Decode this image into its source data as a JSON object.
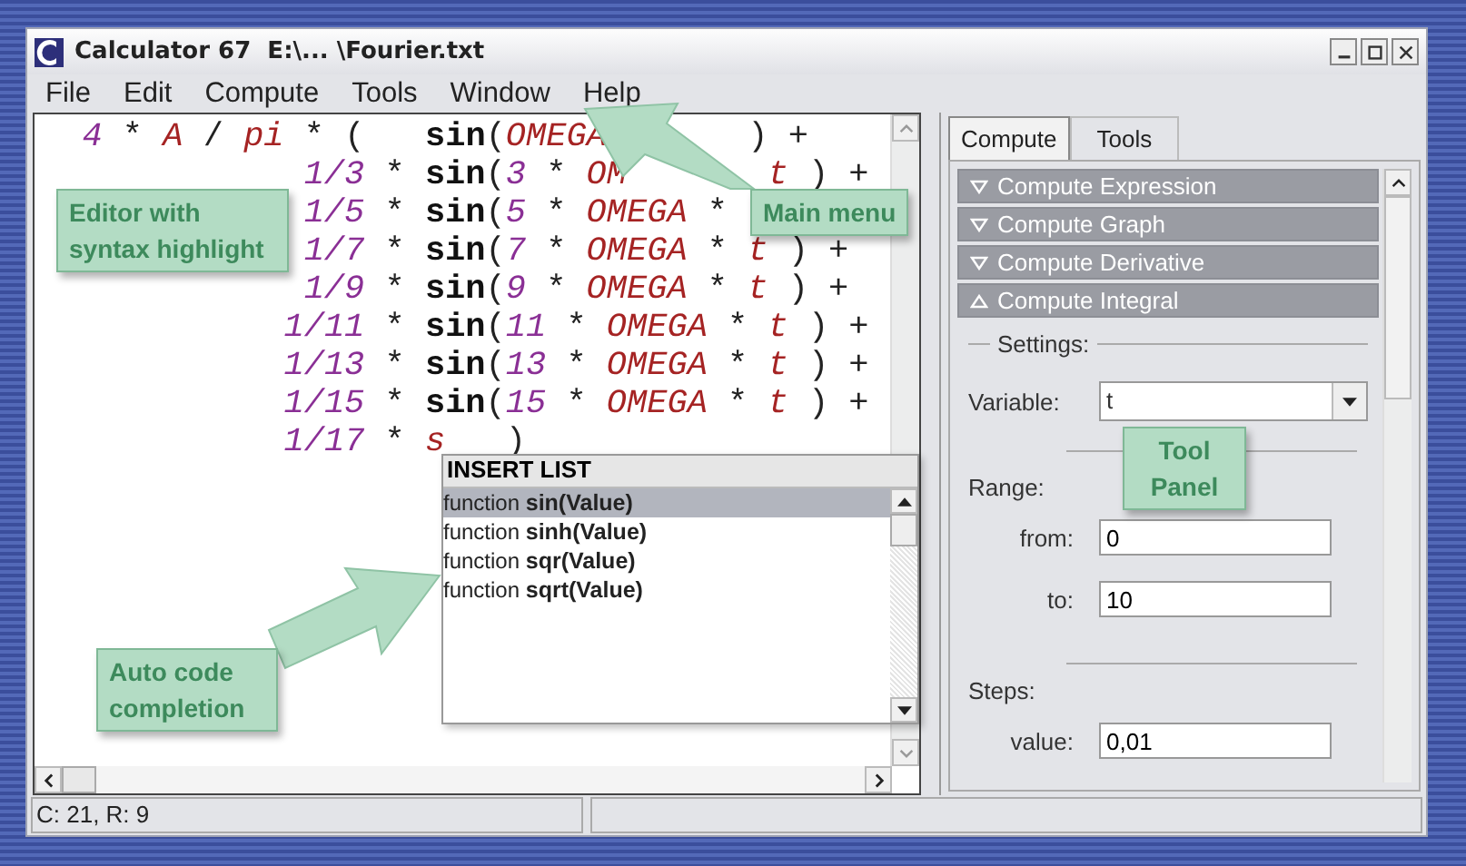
{
  "window": {
    "title": "Calculator 67  E:\\... \\Fourier.txt"
  },
  "menu": [
    "File",
    "Edit",
    "Compute",
    "Tools",
    "Window",
    "Help"
  ],
  "editor": {
    "lines": [
      [
        {
          "kind": "num",
          "text": "  4"
        },
        {
          "kind": "op",
          "text": " * "
        },
        {
          "kind": "var",
          "text": "A"
        },
        {
          "kind": "op",
          "text": " / "
        },
        {
          "kind": "var",
          "text": "pi"
        },
        {
          "kind": "op",
          "text": " * (   "
        },
        {
          "kind": "fn",
          "text": "sin"
        },
        {
          "kind": "op",
          "text": "("
        },
        {
          "kind": "var",
          "text": "OMEGA"
        },
        {
          "kind": "op",
          "text": "       ) +"
        }
      ],
      [
        {
          "kind": "num",
          "text": "             1/3"
        },
        {
          "kind": "op",
          "text": " * "
        },
        {
          "kind": "fn",
          "text": "sin"
        },
        {
          "kind": "op",
          "text": "("
        },
        {
          "kind": "num",
          "text": "3"
        },
        {
          "kind": "op",
          "text": " * "
        },
        {
          "kind": "var",
          "text": "OM"
        },
        {
          "kind": "var",
          "text": "       t"
        },
        {
          "kind": "op",
          "text": " ) +"
        }
      ],
      [
        {
          "kind": "num",
          "text": "             1/5"
        },
        {
          "kind": "op",
          "text": " * "
        },
        {
          "kind": "fn",
          "text": "sin"
        },
        {
          "kind": "op",
          "text": "("
        },
        {
          "kind": "num",
          "text": "5"
        },
        {
          "kind": "op",
          "text": " * "
        },
        {
          "kind": "var",
          "text": "OMEGA"
        },
        {
          "kind": "op",
          "text": " *"
        }
      ],
      [
        {
          "kind": "num",
          "text": "             1/7"
        },
        {
          "kind": "op",
          "text": " * "
        },
        {
          "kind": "fn",
          "text": "sin"
        },
        {
          "kind": "op",
          "text": "("
        },
        {
          "kind": "num",
          "text": "7"
        },
        {
          "kind": "op",
          "text": " * "
        },
        {
          "kind": "var",
          "text": "OMEGA"
        },
        {
          "kind": "op",
          "text": " * "
        },
        {
          "kind": "var",
          "text": "t"
        },
        {
          "kind": "op",
          "text": " ) +"
        }
      ],
      [
        {
          "kind": "num",
          "text": "             1/9"
        },
        {
          "kind": "op",
          "text": " * "
        },
        {
          "kind": "fn",
          "text": "sin"
        },
        {
          "kind": "op",
          "text": "("
        },
        {
          "kind": "num",
          "text": "9"
        },
        {
          "kind": "op",
          "text": " * "
        },
        {
          "kind": "var",
          "text": "OMEGA"
        },
        {
          "kind": "op",
          "text": " * "
        },
        {
          "kind": "var",
          "text": "t"
        },
        {
          "kind": "op",
          "text": " ) +"
        }
      ],
      [
        {
          "kind": "num",
          "text": "            1/11"
        },
        {
          "kind": "op",
          "text": " * "
        },
        {
          "kind": "fn",
          "text": "sin"
        },
        {
          "kind": "op",
          "text": "("
        },
        {
          "kind": "num",
          "text": "11"
        },
        {
          "kind": "op",
          "text": " * "
        },
        {
          "kind": "var",
          "text": "OMEGA"
        },
        {
          "kind": "op",
          "text": " * "
        },
        {
          "kind": "var",
          "text": "t"
        },
        {
          "kind": "op",
          "text": " ) +"
        }
      ],
      [
        {
          "kind": "num",
          "text": "            1/13"
        },
        {
          "kind": "op",
          "text": " * "
        },
        {
          "kind": "fn",
          "text": "sin"
        },
        {
          "kind": "op",
          "text": "("
        },
        {
          "kind": "num",
          "text": "13"
        },
        {
          "kind": "op",
          "text": " * "
        },
        {
          "kind": "var",
          "text": "OMEGA"
        },
        {
          "kind": "op",
          "text": " * "
        },
        {
          "kind": "var",
          "text": "t"
        },
        {
          "kind": "op",
          "text": " ) +"
        }
      ],
      [
        {
          "kind": "num",
          "text": "            1/15"
        },
        {
          "kind": "op",
          "text": " * "
        },
        {
          "kind": "fn",
          "text": "sin"
        },
        {
          "kind": "op",
          "text": "("
        },
        {
          "kind": "num",
          "text": "15"
        },
        {
          "kind": "op",
          "text": " * "
        },
        {
          "kind": "var",
          "text": "OMEGA"
        },
        {
          "kind": "op",
          "text": " * "
        },
        {
          "kind": "var",
          "text": "t"
        },
        {
          "kind": "op",
          "text": " ) +"
        }
      ],
      [
        {
          "kind": "num",
          "text": "            1/17"
        },
        {
          "kind": "op",
          "text": " * "
        },
        {
          "kind": "var",
          "text": "s"
        },
        {
          "kind": "op",
          "text": "   )"
        }
      ]
    ]
  },
  "insert_list": {
    "title": "INSERT LIST",
    "items": [
      {
        "type": "function",
        "name": "sin(Value)",
        "selected": true
      },
      {
        "type": "function",
        "name": "sinh(Value)",
        "selected": false
      },
      {
        "type": "function",
        "name": "sqr(Value)",
        "selected": false
      },
      {
        "type": "function",
        "name": "sqrt(Value)",
        "selected": false
      }
    ]
  },
  "tool_panel": {
    "tabs": [
      {
        "label": "Compute",
        "selected": true
      },
      {
        "label": "Tools",
        "selected": false
      }
    ],
    "sections": [
      {
        "label": "Compute Expression",
        "expanded": false
      },
      {
        "label": "Compute Graph",
        "expanded": false
      },
      {
        "label": "Compute Derivative",
        "expanded": false
      },
      {
        "label": "Compute Integral",
        "expanded": true
      }
    ],
    "settings": [
      {
        "kind": "group",
        "label": "Settings:"
      },
      {
        "kind": "select",
        "label": "Variable:",
        "value": "t"
      },
      {
        "kind": "divider"
      },
      {
        "kind": "heading",
        "label": "Range:"
      },
      {
        "kind": "field",
        "label": "from:",
        "value": "0"
      },
      {
        "kind": "field",
        "label": "to:",
        "value": "10"
      },
      {
        "kind": "divider"
      },
      {
        "kind": "heading",
        "label": "Steps:"
      },
      {
        "kind": "field",
        "label": "value:",
        "value": "0,01"
      }
    ]
  },
  "status_bar": {
    "position": "C: 21, R: 9"
  },
  "callouts": [
    {
      "text": "Editor with syntax highlight"
    },
    {
      "text": "Main menu"
    },
    {
      "text": "Tool Panel"
    },
    {
      "text": "Auto code completion"
    }
  ]
}
